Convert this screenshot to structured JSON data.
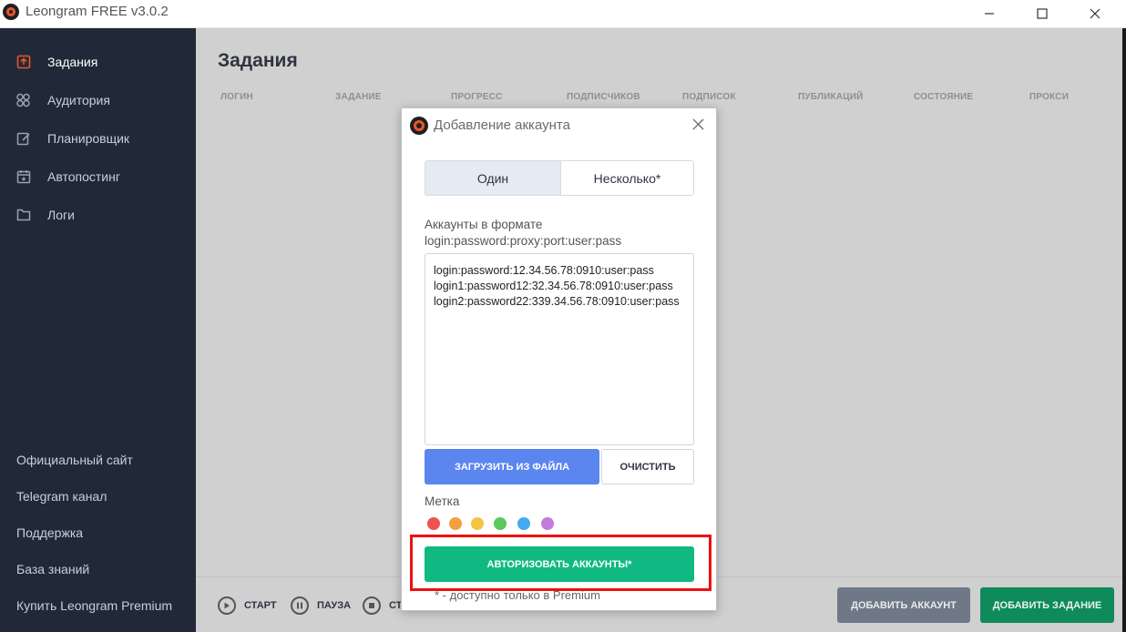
{
  "window": {
    "title": "Leongram FREE v3.0.2",
    "minimize": "—",
    "maximize": "☐",
    "close": "✕"
  },
  "sidebar": {
    "items": [
      {
        "label": "Задания",
        "icon": "tasks-icon",
        "active": true
      },
      {
        "label": "Аудитория",
        "icon": "audience-icon",
        "active": false
      },
      {
        "label": "Планировщик",
        "icon": "scheduler-icon",
        "active": false
      },
      {
        "label": "Автопостинг",
        "icon": "autopost-icon",
        "active": false
      },
      {
        "label": "Логи",
        "icon": "logs-icon",
        "active": false
      }
    ],
    "links": [
      "Официальный сайт",
      "Telegram канал",
      "Поддержка",
      "База знаний",
      "Купить Leongram Premium"
    ],
    "accent_color": "#e8572c"
  },
  "main": {
    "title": "Задания",
    "columns": [
      "ЛОГИН",
      "ЗАДАНИЕ",
      "ПРОГРЕСС",
      "ПОДПИСЧИКОВ",
      "ПОДПИСОК",
      "ПУБЛИКАЦИЙ",
      "СОСТОЯНИЕ",
      "ПРОКСИ"
    ],
    "controls": {
      "start": "СТАРТ",
      "pause": "ПАУЗА",
      "stop": "СТ"
    },
    "add_account_button": "ДОБАВИТЬ АККАУНТ",
    "add_task_button": "ДОБАВИТЬ ЗАДАНИЕ"
  },
  "modal": {
    "title": "Добавление  аккаунта",
    "tabs": {
      "one": "Один",
      "many": "Несколько*",
      "selected": "one"
    },
    "format_label": "Аккаунты в формате login:password:proxy:port:user:pass",
    "accounts_text": "login:password:12.34.56.78:0910:user:pass\nlogin1:password12:32.34.56.78:0910:user:pass\nlogin2:password22:339.34.56.78:0910:user:pass",
    "load_button": "ЗАГРУЗИТЬ ИЗ ФАЙЛА",
    "clear_button": "ОЧИСТИТЬ",
    "tag_label": "Метка",
    "tag_colors": [
      "#f05252",
      "#f59e42",
      "#f5c542",
      "#5ac85a",
      "#42aaf0",
      "#c47bdb"
    ],
    "authorize_button": "АВТОРИЗОВАТЬ АККАУНТЫ*",
    "premium_note": "* - доступно только в Premium",
    "highlight_color": "#ee1010"
  }
}
